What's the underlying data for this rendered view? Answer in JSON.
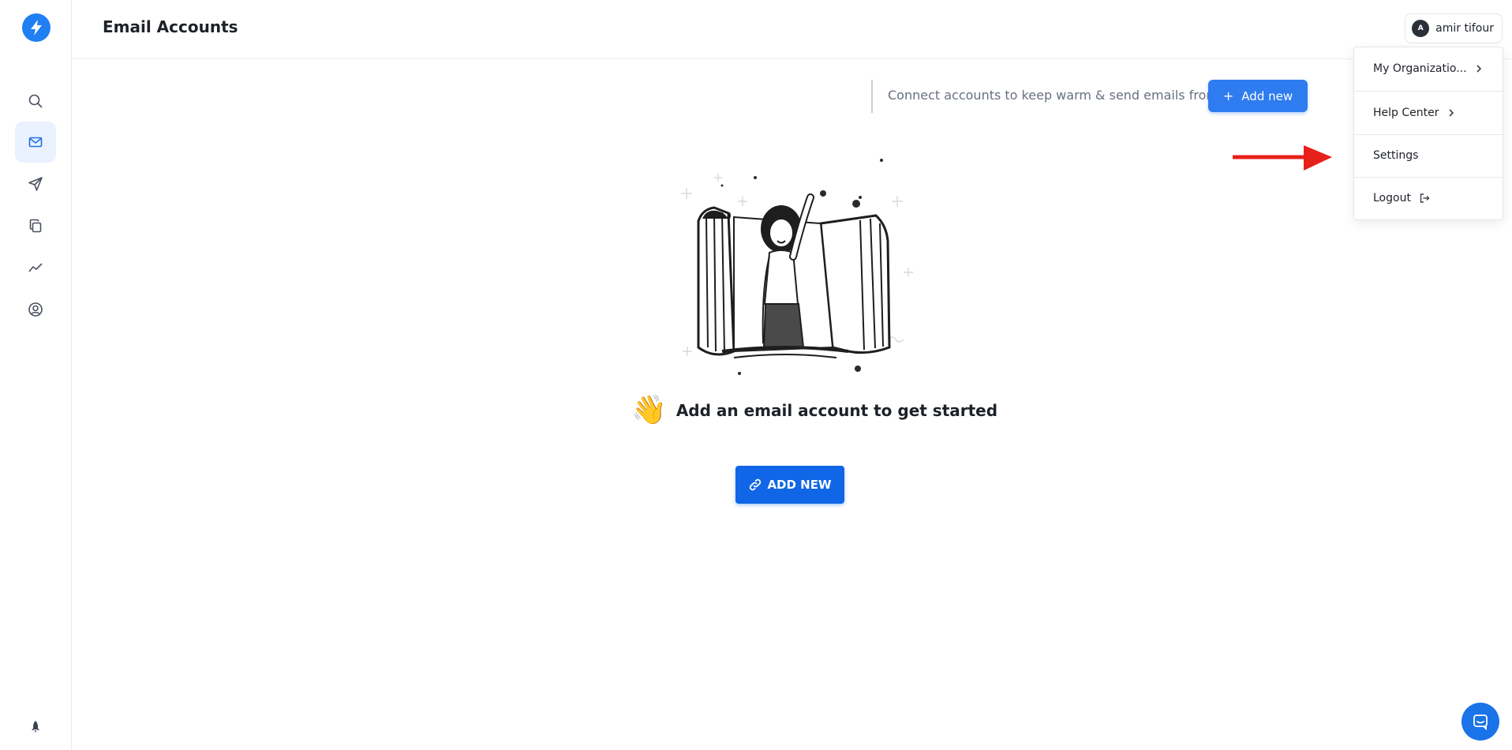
{
  "app": {
    "logo_icon": "bolt-icon",
    "accent_color": "#1f7ff3"
  },
  "sidebar": {
    "items": [
      {
        "icon": "search-icon",
        "active": false
      },
      {
        "icon": "mail-icon",
        "active": true
      },
      {
        "icon": "send-icon",
        "active": false
      },
      {
        "icon": "copy-icon",
        "active": false
      },
      {
        "icon": "trend-icon",
        "active": false
      },
      {
        "icon": "user-circle-icon",
        "active": false
      }
    ],
    "bottom_icon": "rocket-icon"
  },
  "header": {
    "title": "Email Accounts",
    "user": {
      "initial": "A",
      "name": "amir tifour"
    }
  },
  "toolbar": {
    "connect_text": "Connect accounts to keep warm & send emails from",
    "add_new_label": "Add new"
  },
  "empty_state": {
    "emoji": "👋",
    "message": "Add an email account to get started",
    "button_label": "ADD NEW"
  },
  "user_menu": {
    "items": [
      {
        "label": "My Organizatio...",
        "icon": "chevron-right-icon"
      },
      {
        "label": "Help Center",
        "icon": "chevron-right-icon"
      },
      {
        "label": "Settings",
        "icon": ""
      },
      {
        "label": "Logout",
        "icon": "logout-icon"
      }
    ]
  },
  "annotation": {
    "arrow_color": "#e8201a"
  },
  "chat": {
    "icon": "chat-icon",
    "color": "#1a73e8"
  }
}
